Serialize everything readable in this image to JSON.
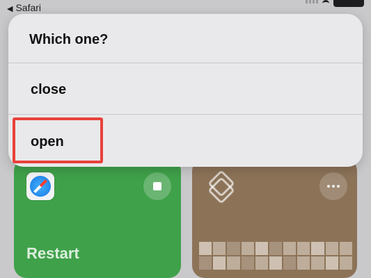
{
  "status_bar": {
    "back_app_label": "Safari",
    "back_icon": "back-triangle-icon",
    "icons": [
      "cellular-signal-icon",
      "wifi-icon",
      "battery-icon"
    ]
  },
  "dialog": {
    "title": "Which one?",
    "options": [
      {
        "label": "close"
      },
      {
        "label": "open"
      }
    ],
    "highlighted_option": "open",
    "highlight_color": "#e8413b"
  },
  "tiles": [
    {
      "label": "Restart",
      "color": "#3fa14a",
      "icon": "safari-icon",
      "action_icon": "stop-icon"
    },
    {
      "label": "",
      "color": "#8c7358",
      "icon": "shortcuts-icon",
      "action_icon": "more-icon"
    }
  ]
}
